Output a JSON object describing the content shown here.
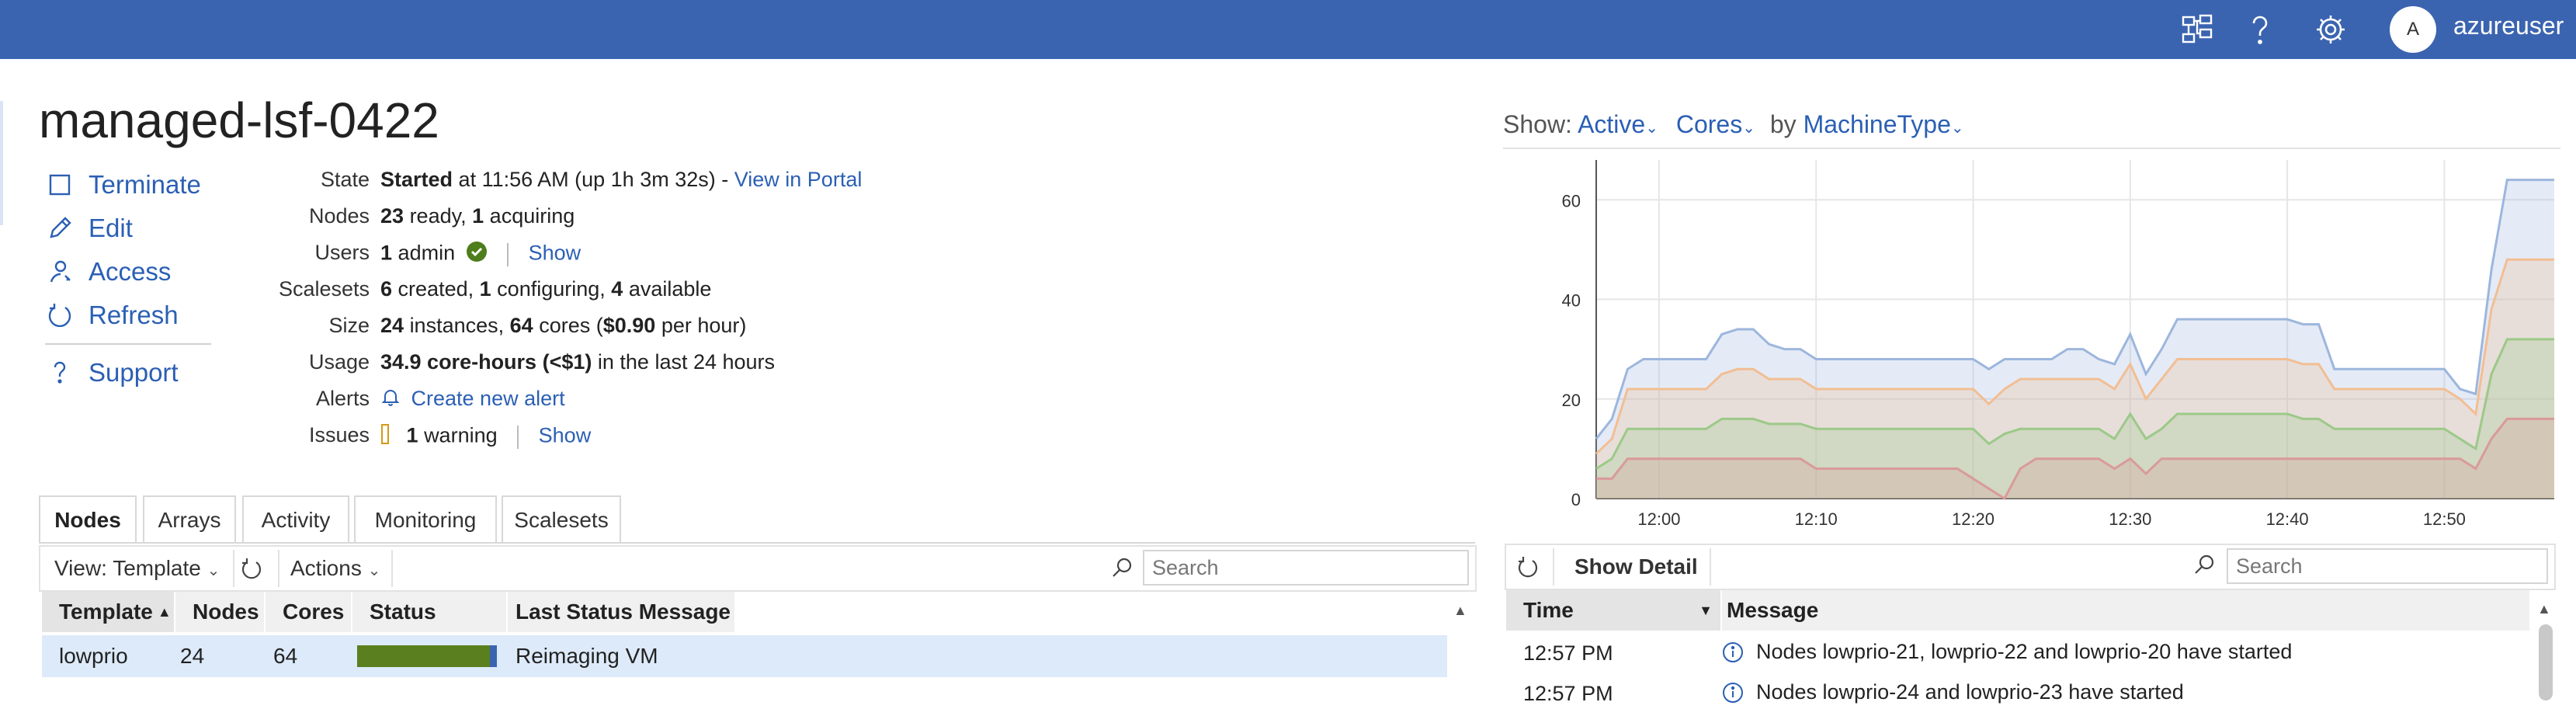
{
  "header": {
    "username": "azureuser",
    "avatar_initial": "A",
    "icons": [
      "network-icon",
      "help-icon",
      "settings-icon"
    ],
    "brand_color": "#3b64b0"
  },
  "cluster": {
    "title": "managed-lsf-0422",
    "actions": [
      {
        "label": "Terminate",
        "icon": "terminate-square-icon"
      },
      {
        "label": "Edit",
        "icon": "pencil-icon"
      },
      {
        "label": "Access",
        "icon": "user-key-icon"
      },
      {
        "label": "Refresh",
        "icon": "refresh-icon"
      },
      {
        "label": "Support",
        "icon": "question-icon"
      }
    ]
  },
  "info": {
    "state_label": "State",
    "state_value": "Started",
    "state_detail": "at 11:56 AM (up 1h 3m 32s) -",
    "state_link": "View in Portal",
    "nodes_label": "Nodes",
    "nodes_ready": "23",
    "nodes_ready_text": "ready,",
    "nodes_acquiring": "1",
    "nodes_acquiring_text": "acquiring",
    "users_label": "Users",
    "users_count": "1",
    "users_text": "admin",
    "users_show": "Show",
    "scalesets_label": "Scalesets",
    "scalesets_created": "6",
    "scalesets_created_text": "created,",
    "scalesets_configuring": "1",
    "scalesets_configuring_text": "configuring,",
    "scalesets_available": "4",
    "scalesets_available_text": "available",
    "size_label": "Size",
    "size_instances": "24",
    "size_instances_text": "instances,",
    "size_cores": "64",
    "size_cores_text": "cores (",
    "size_price": "$0.90",
    "size_price_text": "per hour)",
    "usage_label": "Usage",
    "usage_value": "34.9 core-hours (<$1)",
    "usage_text": "in the last 24 hours",
    "alerts_label": "Alerts",
    "alerts_link": "Create new alert",
    "issues_label": "Issues",
    "issues_count": "1",
    "issues_text": "warning",
    "issues_show": "Show"
  },
  "tabs": [
    "Nodes",
    "Arrays",
    "Activity",
    "Monitoring",
    "Scalesets"
  ],
  "nodes_toolbar": {
    "view_label": "View: Template",
    "actions_label": "Actions",
    "search_placeholder": "Search"
  },
  "nodes_table": {
    "columns": [
      "Template",
      "Nodes",
      "Cores",
      "Status",
      "Last Status Message"
    ],
    "rows": [
      {
        "template": "lowprio",
        "nodes": "24",
        "cores": "64",
        "status_fill": 0.95,
        "message": "Reimaging VM"
      }
    ]
  },
  "chart_controls": {
    "show_label": "Show:",
    "metric": "Active",
    "unit": "Cores",
    "by_label": "by",
    "group": "MachineType"
  },
  "chart_data": {
    "type": "area",
    "stacked": false,
    "x": [
      "11:56",
      "11:57",
      "11:58",
      "11:59",
      "12:00",
      "12:01",
      "12:02",
      "12:03",
      "12:04",
      "12:05",
      "12:06",
      "12:07",
      "12:08",
      "12:09",
      "12:10",
      "12:11",
      "12:12",
      "12:13",
      "12:14",
      "12:15",
      "12:16",
      "12:17",
      "12:18",
      "12:19",
      "12:20",
      "12:21",
      "12:22",
      "12:23",
      "12:24",
      "12:25",
      "12:26",
      "12:27",
      "12:28",
      "12:29",
      "12:30",
      "12:31",
      "12:32",
      "12:33",
      "12:34",
      "12:35",
      "12:36",
      "12:37",
      "12:38",
      "12:39",
      "12:40",
      "12:41",
      "12:42",
      "12:43",
      "12:44",
      "12:45",
      "12:46",
      "12:47",
      "12:48",
      "12:49",
      "12:50",
      "12:51",
      "12:52",
      "12:53",
      "12:54",
      "12:55",
      "12:56",
      "12:57"
    ],
    "x_ticks": [
      "12:00",
      "12:10",
      "12:20",
      "12:30",
      "12:40",
      "12:50"
    ],
    "y_ticks": [
      0,
      20,
      40,
      60
    ],
    "ylim": [
      0,
      68
    ],
    "series": [
      {
        "color": "#9db6dd",
        "values": [
          12,
          16,
          26,
          28,
          28,
          28,
          28,
          28,
          33,
          34,
          34,
          31,
          30,
          30,
          28,
          28,
          28,
          28,
          28,
          28,
          28,
          28,
          28,
          28,
          28,
          26,
          28,
          28,
          28,
          28,
          30,
          30,
          28,
          27,
          33,
          25,
          30,
          36,
          36,
          36,
          36,
          36,
          36,
          36,
          36,
          35,
          35,
          26,
          26,
          26,
          26,
          26,
          26,
          26,
          26,
          22,
          21,
          46,
          64,
          64,
          64,
          64
        ]
      },
      {
        "color": "#f2be93",
        "values": [
          9,
          12,
          22,
          22,
          22,
          22,
          22,
          22,
          25,
          26,
          26,
          24,
          24,
          24,
          22,
          22,
          22,
          22,
          22,
          22,
          22,
          22,
          22,
          22,
          22,
          19,
          22,
          24,
          24,
          24,
          24,
          24,
          24,
          22,
          27,
          20,
          24,
          28,
          28,
          28,
          28,
          28,
          28,
          28,
          28,
          27,
          27,
          22,
          22,
          22,
          22,
          22,
          22,
          22,
          22,
          20,
          17,
          38,
          48,
          48,
          48,
          48
        ]
      },
      {
        "color": "#9cc988",
        "values": [
          6,
          8,
          14,
          14,
          14,
          14,
          14,
          14,
          16,
          16,
          16,
          15,
          15,
          15,
          14,
          14,
          14,
          14,
          14,
          14,
          14,
          14,
          14,
          14,
          14,
          11,
          13,
          14,
          14,
          14,
          14,
          14,
          14,
          12,
          17,
          12,
          14,
          17,
          17,
          17,
          17,
          17,
          17,
          17,
          17,
          16,
          16,
          14,
          14,
          14,
          14,
          14,
          14,
          14,
          14,
          12,
          10,
          25,
          32,
          32,
          32,
          32
        ]
      },
      {
        "color": "#d99a9a",
        "values": [
          4,
          4,
          8,
          8,
          8,
          8,
          8,
          8,
          8,
          8,
          8,
          8,
          8,
          8,
          6,
          6,
          6,
          6,
          6,
          6,
          6,
          6,
          6,
          6,
          4,
          2,
          0,
          6,
          8,
          8,
          8,
          8,
          8,
          6,
          8,
          5,
          8,
          8,
          8,
          8,
          8,
          8,
          8,
          8,
          8,
          8,
          8,
          8,
          8,
          8,
          8,
          8,
          8,
          8,
          8,
          8,
          6,
          12,
          16,
          16,
          16,
          16
        ]
      }
    ]
  },
  "events_toolbar": {
    "show_detail_label": "Show Detail",
    "search_placeholder": "Search"
  },
  "events_table": {
    "columns": [
      "Time",
      "Message"
    ],
    "rows": [
      {
        "time": "12:57 PM",
        "message": "Nodes lowprio-21, lowprio-22 and lowprio-20 have started"
      },
      {
        "time": "12:57 PM",
        "message": "Nodes lowprio-24 and lowprio-23 have started"
      }
    ]
  },
  "colors": {
    "link": "#2b5fb4",
    "status_bar": "#5a7f1e",
    "selected_row": "#ddeaf9",
    "ok_badge": "#4e7d1c",
    "warning": "#d49a16"
  }
}
